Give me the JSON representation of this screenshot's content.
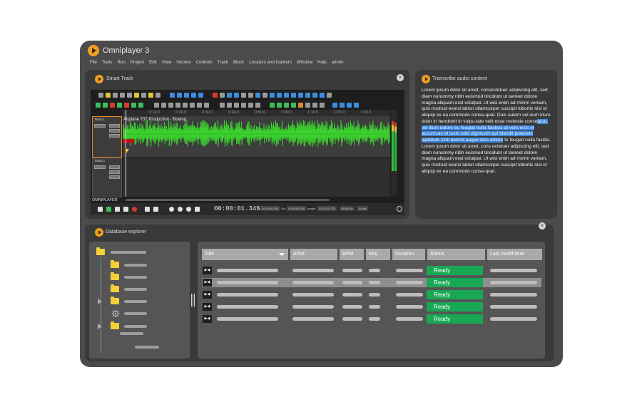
{
  "app": {
    "title": "Omniplayer 3"
  },
  "menu": [
    "File",
    "Tools",
    "Run",
    "Project",
    "Edit",
    "View",
    "Volume",
    "Controls",
    "Track",
    "Block",
    "Locators and markers",
    "Window",
    "Help",
    "admin"
  ],
  "smart_track": {
    "title": "Smart Track",
    "ruler": [
      "0:10.0",
      "0:20.0",
      "0:30.0",
      "0:40.0",
      "0:50.0",
      "1:00.0",
      "1:10.0",
      "1:20.0",
      "1:30.0"
    ],
    "tracks": [
      {
        "name": "Track 1"
      },
      {
        "name": "Track 2"
      }
    ],
    "clip_title": "Airplane 737 Production - Boeing",
    "brand": "OMNIPLAYER",
    "time": "00:00:01.345",
    "in_label": "In",
    "in_value": "00:00:00.000",
    "out_label": "Out",
    "out_value": "00:00:00.000",
    "length_label": "Length",
    "length_value": "00:01:30.373",
    "rate": "48000 Hz",
    "bits": "16 bits"
  },
  "transcribe": {
    "title": "Transcribe audio content",
    "text_a": "Lorem ipsum dolor sit amet, consectetuer adipiscing elit, sed diam nonummy nibh euismod tincidunt ut laoreet dolore magna aliquam erat volutpat. Ut wisi enim ad minim veniam, quis nostrud exerci tation ullamcorper suscipit lobortis nisl ut aliquip ex ea commodo conse-quat. Duis autem vel eum iriure dolor in hendrerit in vulpu-tate velit esse molestie conse",
    "text_hl": "quat, vel illum dolore eu feugiat nulla facilisis at vero eros et accumsan et iusto odio dignissim qui blandit praesent luptatum zzril delenit augue duis dolore",
    "text_b": " te feugait nulla facilisi.",
    "text_c": "Lorem ipsum dolor sit amet, cons ectetuer adipiscing elit, sed diam nonummy nibh euismod tincidunt ut laoreet dolore magna aliquam erat volutpat. Ut wisi enim ad minim veniam, quis nostrud exerci tation ullamcorper suscipit lobortis nisl ut aliquip ex ea commodo conse-quat."
  },
  "db": {
    "title": "Database explorer",
    "columns": [
      "Title",
      "Artist",
      "BPM",
      "Key",
      "Duration",
      "Status",
      "Last modif time"
    ],
    "rows": [
      {
        "status": "Ready"
      },
      {
        "status": "Ready"
      },
      {
        "status": "Ready"
      },
      {
        "status": "Ready"
      },
      {
        "status": "Ready"
      }
    ]
  },
  "colors": {
    "accent": "#f0a020",
    "waveform": "#3bd12e",
    "ready": "#18a854",
    "highlight": "#3a86e0"
  },
  "icons": [
    "play-logo-icon",
    "close-icon",
    "folder-icon",
    "gear-icon",
    "expand-arrow-icon",
    "play-pause-icon",
    "chevron-down-icon"
  ]
}
